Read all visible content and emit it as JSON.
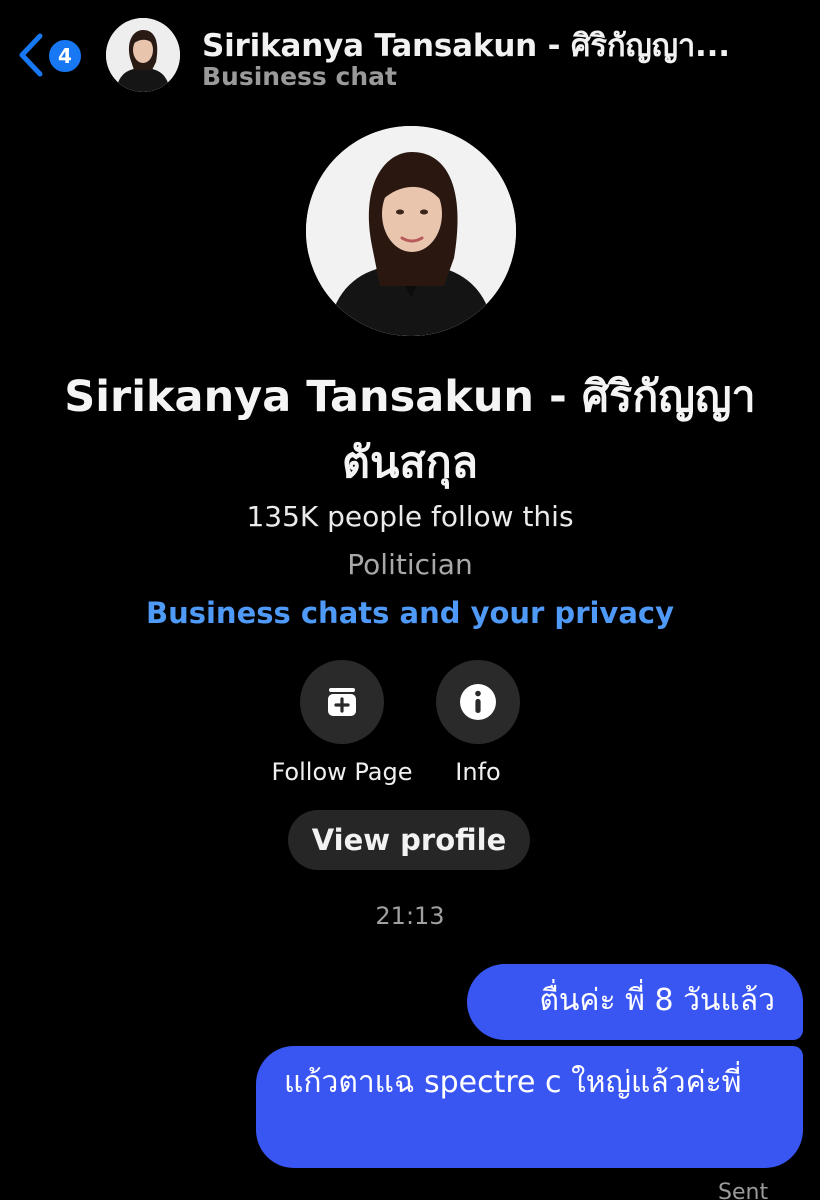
{
  "header": {
    "back_badge_count": "4",
    "title": "Sirikanya Tansakun - ศิริกัญญา...",
    "subtitle": "Business chat"
  },
  "profile": {
    "name": "Sirikanya Tansakun - ศิริกัญญา ตันสกุล",
    "followers": "135K people follow this",
    "category": "Politician",
    "privacy_link": "Business chats and your privacy"
  },
  "actions": {
    "follow_page_label": "Follow Page",
    "info_label": "Info",
    "view_profile_label": "View profile"
  },
  "conversation": {
    "timestamp": "21:13",
    "messages": [
      {
        "text": "ตื่นค่ะ พี่ 8 วันแล้ว"
      },
      {
        "text": "แก้วตาแฉ spectre c ใหญ่แล้วค่ะพี่"
      }
    ],
    "status": "Sent"
  },
  "icons": {
    "back": "chevron-left-icon",
    "follow": "follow-page-icon",
    "info": "info-icon"
  },
  "colors": {
    "accent": "#1877f2",
    "bubble": "#3a56f2",
    "link": "#4f99f7",
    "background": "#000000"
  }
}
